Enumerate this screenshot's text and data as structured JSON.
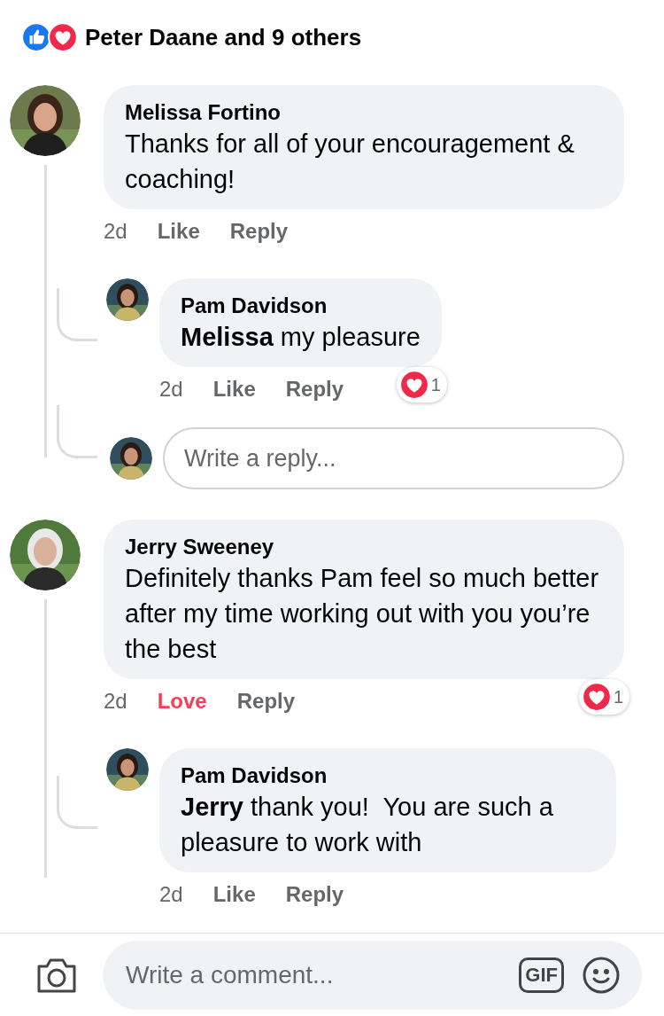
{
  "reactions": {
    "summary": "Peter Daane and 9 others"
  },
  "comments": [
    {
      "author": "Melissa Fortino",
      "text": "Thanks for all of your encouragement & coaching!",
      "time": "2d",
      "actions": [
        {
          "label": "Like",
          "reacted": false
        },
        {
          "label": "Reply",
          "reacted": false
        }
      ],
      "replies": [
        {
          "author": "Pam Davidson",
          "text": "**Melissa** my pleasure",
          "time": "2d",
          "actions": [
            {
              "label": "Like",
              "reacted": false
            },
            {
              "label": "Reply",
              "reacted": false
            }
          ],
          "reaction": {
            "count": "1"
          }
        }
      ],
      "reply_box": {
        "placeholder": "Write a reply..."
      }
    },
    {
      "author": "Jerry Sweeney",
      "text": "Definitely thanks Pam feel so much better after my time working out with you you’re the best",
      "time": "2d",
      "actions": [
        {
          "label": "Love",
          "reacted": true
        },
        {
          "label": "Reply",
          "reacted": false
        }
      ],
      "reaction": {
        "count": "1"
      },
      "replies": [
        {
          "author": "Pam Davidson",
          "text": "**Jerry** thank you!  You are such a pleasure to work with",
          "time": "2d",
          "actions": [
            {
              "label": "Like",
              "reacted": false
            },
            {
              "label": "Reply",
              "reacted": false
            }
          ]
        }
      ]
    }
  ],
  "composer": {
    "placeholder": "Write a comment...",
    "gif": "GIF"
  }
}
